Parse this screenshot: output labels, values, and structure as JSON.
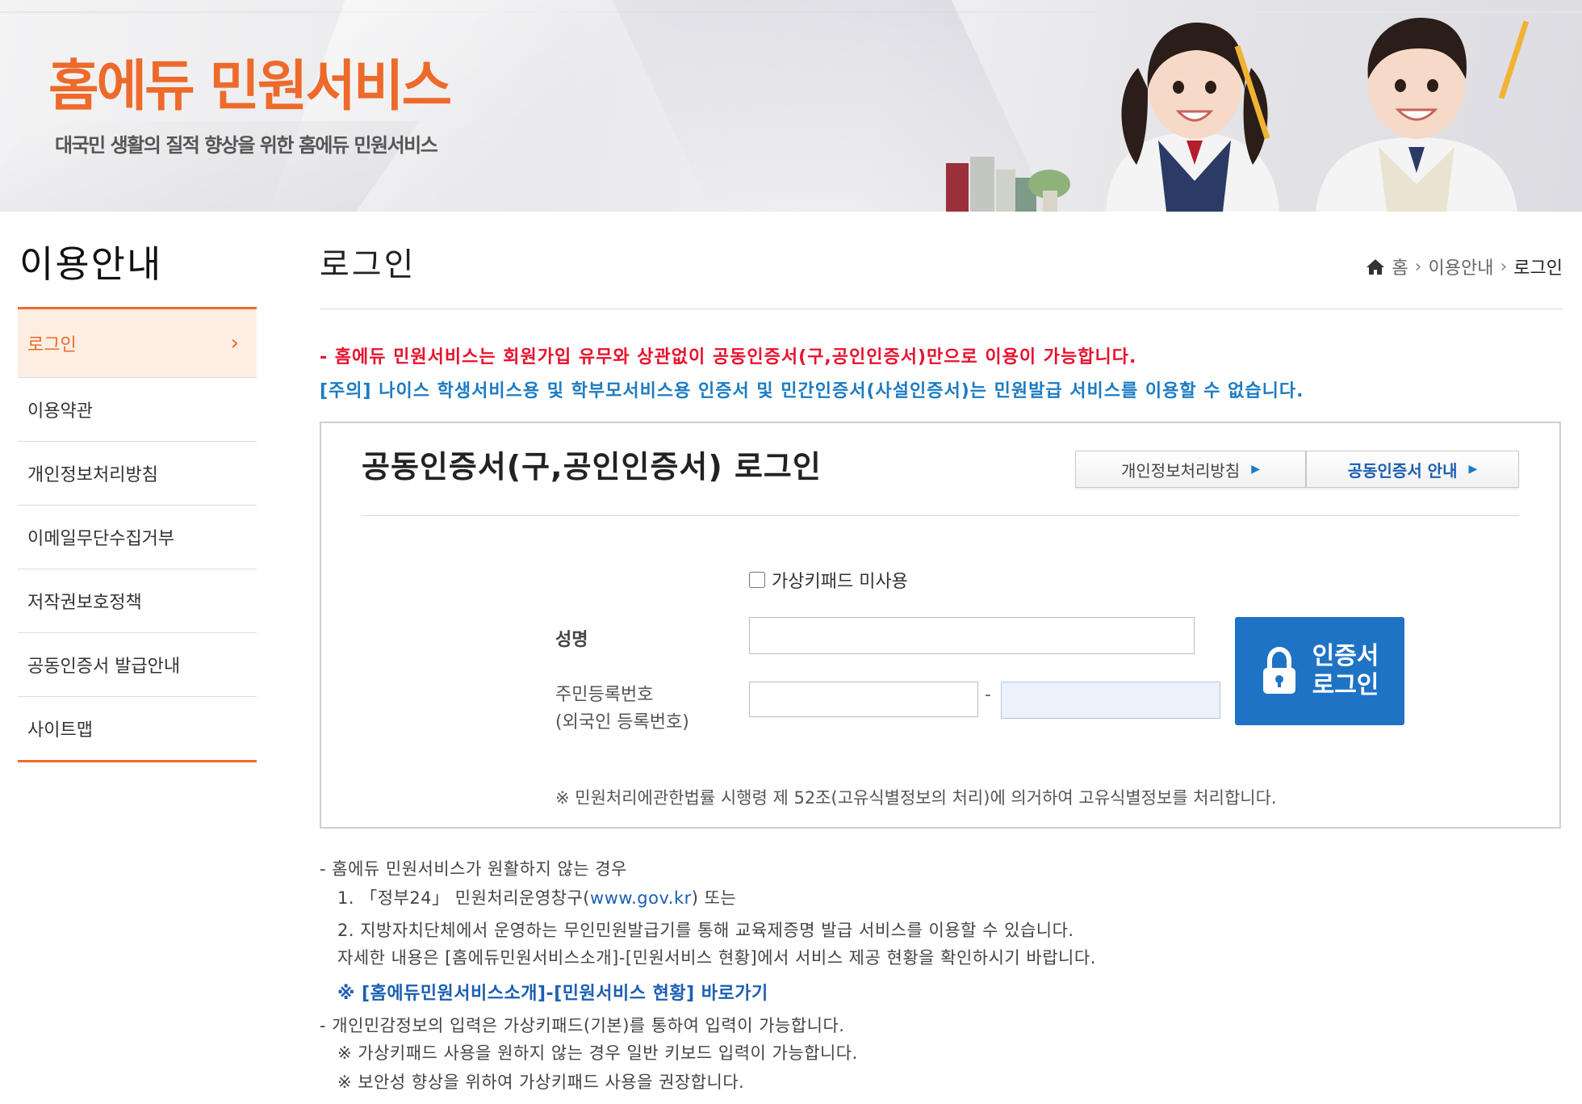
{
  "banner": {
    "title": "홈에듀 민원서비스",
    "subtitle": "대국민 생활의 질적 향상을 위한 홈에듀 민원서비스"
  },
  "sidebar": {
    "title": "이용안내",
    "items": [
      {
        "label": "로그인",
        "active": true
      },
      {
        "label": "이용약관"
      },
      {
        "label": "개인정보처리방침"
      },
      {
        "label": "이메일무단수집거부"
      },
      {
        "label": "저작권보호정책"
      },
      {
        "label": "공동인증서 발급안내"
      },
      {
        "label": "사이트맵"
      }
    ]
  },
  "page": {
    "title": "로그인",
    "breadcrumb": [
      "홈",
      "이용안내",
      "로그인"
    ]
  },
  "notices": {
    "red": "- 홈에듀 민원서비스는 회원가입 유무와 상관없이 공동인증서(구,공인인증서)만으로 이용이 가능합니다.",
    "blue": "[주의] 나이스 학생서비스용 및 학부모서비스용 인증서 및 민간인증서(사설인증서)는 민원발급 서비스를 이용할 수 없습니다."
  },
  "login": {
    "title": "공동인증서(구,공인인증서) 로그인",
    "privacy_button": "개인정보처리방침",
    "cert_guide_button": "공동인증서 안내",
    "virtual_keypad_label": "가상키패드 미사용",
    "virtual_keypad_checked": false,
    "name_label": "성명",
    "name_value": "",
    "rrn_label_1": "주민등록번호",
    "rrn_label_2": "(외국인 등록번호)",
    "rrn_front_value": "",
    "rrn_back_value": "",
    "rrn_separator": "-",
    "cert_button_label": "인증서\n로그인",
    "note": "※ 민원처리에관한법률 시행령 제 52조(고유식별정보의 처리)에 의거하여 고유식별정보를 처리합니다."
  },
  "info": {
    "line1": "- 홈에듀 민원서비스가 원활하지 않는 경우",
    "line2_pre": "1. 「정부24」 민원처리운영창구(",
    "line2_link": "www.gov.kr",
    "line2_post": ") 또는",
    "line3": "2. 지방자치단체에서 운영하는 무인민원발급기를 통해 교육제증명 발급 서비스를 이용할 수 있습니다.",
    "line4": "자세한 내용은 [홈에듀민원서비스소개]-[민원서비스 현황]에서 서비스 제공 현황을 확인하시기 바랍니다.",
    "link": "※ [홈에듀민원서비스소개]-[민원서비스 현황] 바로가기",
    "line5": "- 개인민감정보의 입력은 가상키패드(기본)를 통하여 입력이 가능합니다.",
    "line6": "※ 가상키패드 사용을 원하지 않는 경우 일반 키보드 입력이 가능합니다.",
    "line7": "※ 보안성 향상을 위하여 가상키패드 사용을 권장합니다."
  },
  "colors": {
    "accent_orange": "#ee6a2a",
    "notice_red": "#e8112d",
    "notice_blue": "#1b7bc3",
    "cert_button": "#1f73c4"
  }
}
